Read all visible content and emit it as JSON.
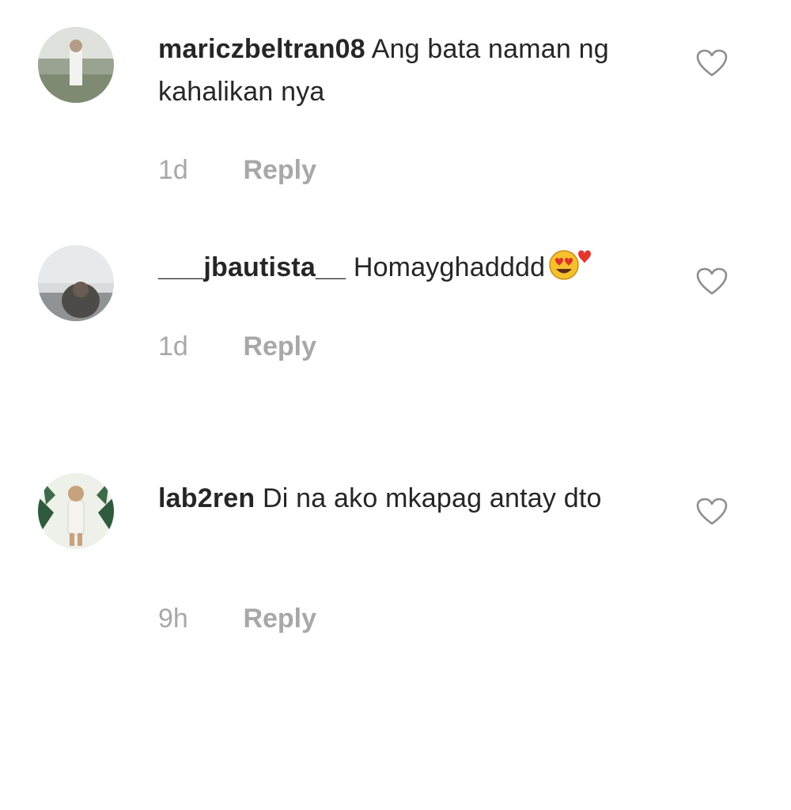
{
  "comments": [
    {
      "username": "mariczbeltran08",
      "text": "Ang bata naman ng kahalikan nya",
      "time": "1d",
      "reply_label": "Reply",
      "avatar_icon": "profile-photo-icon",
      "like_icon": "heart-outline-icon"
    },
    {
      "username": "___jbautista__",
      "text": "Homayghadddd",
      "emoji": "heart-eyes-emoji",
      "time": "1d",
      "reply_label": "Reply",
      "avatar_icon": "profile-photo-icon",
      "like_icon": "heart-outline-icon"
    },
    {
      "username": "lab2ren",
      "text": "Di na ako mkapag antay dto",
      "time": "9h",
      "reply_label": "Reply",
      "avatar_icon": "profile-photo-icon",
      "like_icon": "heart-outline-icon"
    }
  ],
  "colors": {
    "text": "#262626",
    "muted": "#a8a8a8",
    "background": "#ffffff"
  }
}
